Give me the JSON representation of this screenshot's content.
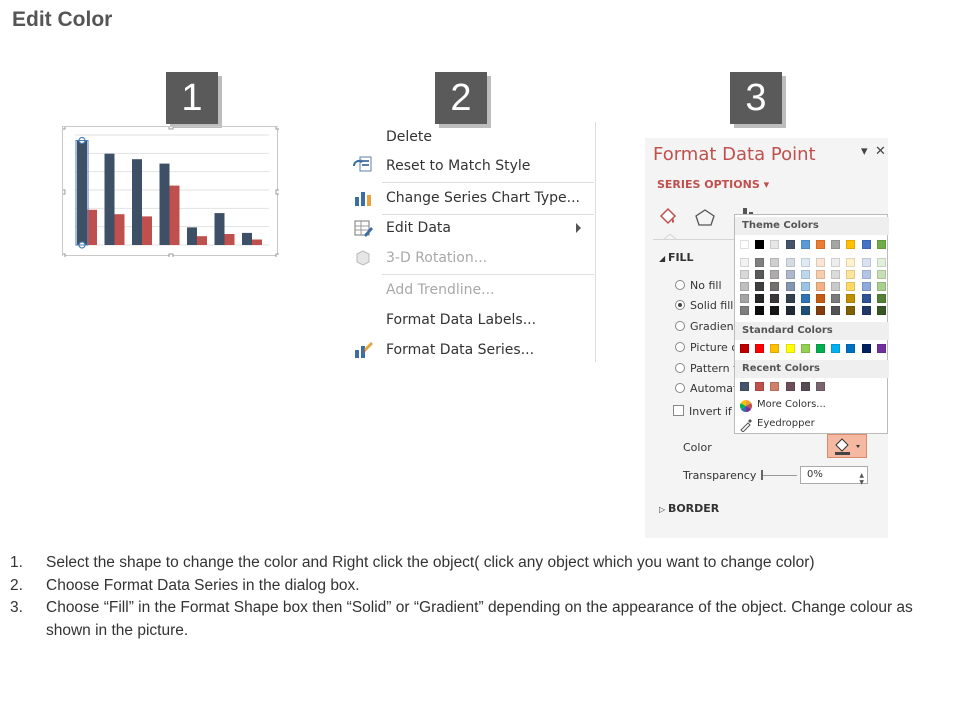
{
  "title": "Edit Color",
  "steps": [
    "1",
    "2",
    "3"
  ],
  "chart": {
    "values_dark": [
      95,
      83,
      78,
      74,
      16,
      29,
      11
    ],
    "values_red": [
      32,
      28,
      26,
      54,
      8,
      10,
      5
    ],
    "colors": {
      "dark": "#3d5066",
      "red": "#c0504d"
    }
  },
  "context_menu": {
    "items": [
      {
        "label": "Delete",
        "enabled": true,
        "icon": ""
      },
      {
        "label": "Reset to Match Style",
        "enabled": true,
        "icon": "reset-style-icon"
      },
      {
        "label": "Change Series Chart Type...",
        "enabled": true,
        "icon": "chart-type-icon"
      },
      {
        "label": "Edit Data",
        "enabled": true,
        "icon": "edit-data-icon",
        "submenu": true
      },
      {
        "label": "3-D Rotation...",
        "enabled": false,
        "icon": "cube-icon"
      },
      {
        "label": "Add Trendline...",
        "enabled": false,
        "icon": ""
      },
      {
        "label": "Format Data Labels...",
        "enabled": true,
        "icon": ""
      },
      {
        "label": "Format Data Series...",
        "enabled": true,
        "icon": "format-series-icon"
      }
    ]
  },
  "format_pane": {
    "title": "Format Data Point",
    "series_options": "SERIES OPTIONS",
    "fill_header": "FILL",
    "fill_options": [
      {
        "label": "No fill",
        "selected": false
      },
      {
        "label": "Solid fill",
        "selected": true
      },
      {
        "label": "Gradient",
        "selected": false
      },
      {
        "label": "Picture o",
        "selected": false
      },
      {
        "label": "Pattern f",
        "selected": false
      },
      {
        "label": "Automat",
        "selected": false
      }
    ],
    "invert_label": "Invert if n",
    "color_label": "Color",
    "transparency_label": "Transparency",
    "transparency_value": "0%",
    "border_header": "BORDER",
    "accent_color": "#c0504d"
  },
  "color_picker": {
    "theme_colors_label": "Theme Colors",
    "standard_colors_label": "Standard Colors",
    "recent_colors_label": "Recent Colors",
    "more_colors_label": "More Colors...",
    "eyedropper_label": "Eyedropper",
    "theme_top": [
      "#ffffff",
      "#000000",
      "#e7e6e6",
      "#44546a",
      "#5b9bd5",
      "#ed7d31",
      "#a5a5a5",
      "#ffc000",
      "#4472c4",
      "#70ad47"
    ],
    "theme_shades": [
      [
        "#f2f2f2",
        "#7f7f7f",
        "#d0cece",
        "#d6dce4",
        "#deebf6",
        "#fbe5d5",
        "#ededed",
        "#fff2cc",
        "#d9e2f3",
        "#e2efd9"
      ],
      [
        "#d8d8d8",
        "#595959",
        "#aeabab",
        "#adb9ca",
        "#bdd7ee",
        "#f7cbac",
        "#dbdbdb",
        "#fee599",
        "#b4c6e7",
        "#c5e0b3"
      ],
      [
        "#bfbfbf",
        "#3f3f3f",
        "#757070",
        "#8496b0",
        "#9cc3e5",
        "#f4b183",
        "#c9c9c9",
        "#ffd965",
        "#8eaadb",
        "#a8d08d"
      ],
      [
        "#a5a5a5",
        "#262626",
        "#3a3838",
        "#323f4f",
        "#2e75b5",
        "#c55a11",
        "#7b7b7b",
        "#bf9000",
        "#2f5496",
        "#538135"
      ],
      [
        "#7f7f7f",
        "#0c0c0c",
        "#171616",
        "#222a35",
        "#1e4e79",
        "#833c0b",
        "#525252",
        "#7f6000",
        "#1f3864",
        "#375623"
      ]
    ],
    "standard": [
      "#c00000",
      "#ff0000",
      "#ffc000",
      "#ffff00",
      "#92d050",
      "#00b050",
      "#00b0f0",
      "#0070c0",
      "#002060",
      "#7030a0"
    ],
    "recent": [
      "#44546a",
      "#c0504d",
      "#d07f6b",
      "#6b4e5a",
      "#5a4a55",
      "#7a6470"
    ]
  },
  "instructions": [
    {
      "num": "1.",
      "text": "Select the shape to change the color and Right click the object( click any object which you want to change color)"
    },
    {
      "num": "2.",
      "text": "Choose Format Data Series in the dialog box."
    },
    {
      "num": "3.",
      "text": "Choose “Fill” in the Format Shape box then “Solid” or “Gradient” depending on the appearance of the object. Change colour as shown in the picture."
    }
  ]
}
